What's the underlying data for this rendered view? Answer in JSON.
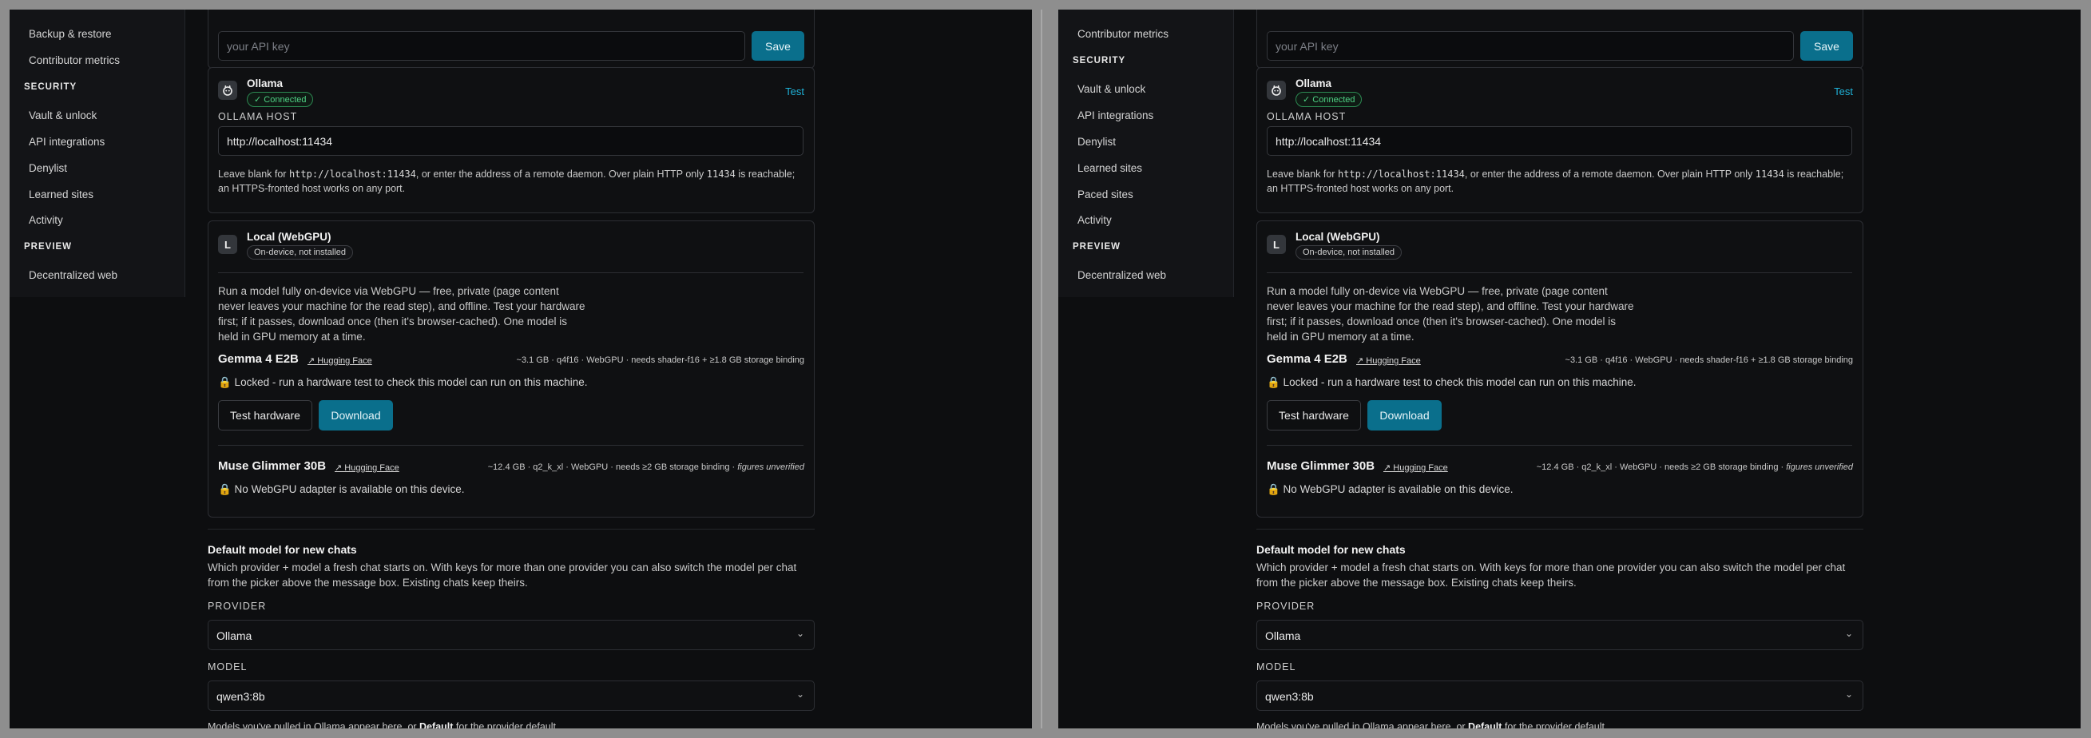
{
  "sidebar_left": {
    "top_items": [
      "Backup & restore",
      "Contributor metrics"
    ],
    "security_head": "SECURITY",
    "security_items": [
      "Vault & unlock",
      "API integrations",
      "Denylist",
      "Learned sites",
      "Activity"
    ],
    "preview_head": "PREVIEW",
    "preview_items": [
      "Decentralized web"
    ]
  },
  "sidebar_right": {
    "top_items": [
      "Contributor metrics"
    ],
    "security_head": "SECURITY",
    "security_items": [
      "Vault & unlock",
      "API integrations",
      "Denylist",
      "Learned sites",
      "Paced sites",
      "Activity"
    ],
    "preview_head": "PREVIEW",
    "preview_items": [
      "Decentralized web"
    ]
  },
  "api_key": {
    "placeholder": "your API key",
    "save_label": "Save"
  },
  "ollama": {
    "name": "Ollama",
    "status": "✓ Connected",
    "test_label": "Test",
    "host_label": "OLLAMA HOST",
    "host_value": "http://localhost:11434",
    "help_pre": "Leave blank for ",
    "help_code1": "http://localhost:11434",
    "help_mid": ", or enter the address of a remote daemon. Over plain HTTP only ",
    "help_code2": "11434",
    "help_post": " is reachable; an HTTPS-fronted host works on any port."
  },
  "webgpu": {
    "tile": "L",
    "name": "Local (WebGPU)",
    "status": "On-device, not installed",
    "description": "Run a model fully on-device via WebGPU — free, private (page content never leaves your machine for the read step), and offline. Test your hardware first; if it passes, download once (then it's browser-cached). One model is held in GPU memory at a time.",
    "models": [
      {
        "name": "Gemma 4 E2B",
        "hf_link": "↗ Hugging Face",
        "meta": "~3.1 GB · q4f16 · WebGPU · needs shader-f16 + ≥1.8 GB storage binding",
        "meta_note": "",
        "lock_text": "🔒 Locked - run a hardware test to check this model can run on this machine.",
        "test_label": "Test hardware",
        "download_label": "Download"
      },
      {
        "name": "Muse Glimmer 30B",
        "hf_link": "↗ Hugging Face",
        "meta": "~12.4 GB · q2_k_xl · WebGPU · needs ≥2 GB storage binding · ",
        "meta_note": "figures unverified",
        "lock_text": "🔒 No WebGPU adapter is available on this device."
      }
    ]
  },
  "default_model": {
    "title": "Default model for new chats",
    "description": "Which provider + model a fresh chat starts on. With keys for more than one provider you can also switch the model per chat from the picker above the message box. Existing chats keep theirs.",
    "provider_label": "PROVIDER",
    "provider_value": "Ollama",
    "model_label": "MODEL",
    "model_value": "qwen3:8b",
    "foot_pre": "Models you've pulled in Ollama appear here, or ",
    "foot_bold": "Default",
    "foot_post": " for the provider default."
  },
  "icons": {
    "ollama": "ollama-llama-icon",
    "chevron": "chevron-down-icon",
    "lock": "lock-icon"
  },
  "colors": {
    "accent": "#0a6f8c",
    "link": "#1fb2d8",
    "success": "#4fd184",
    "background": "#0d0e10"
  }
}
